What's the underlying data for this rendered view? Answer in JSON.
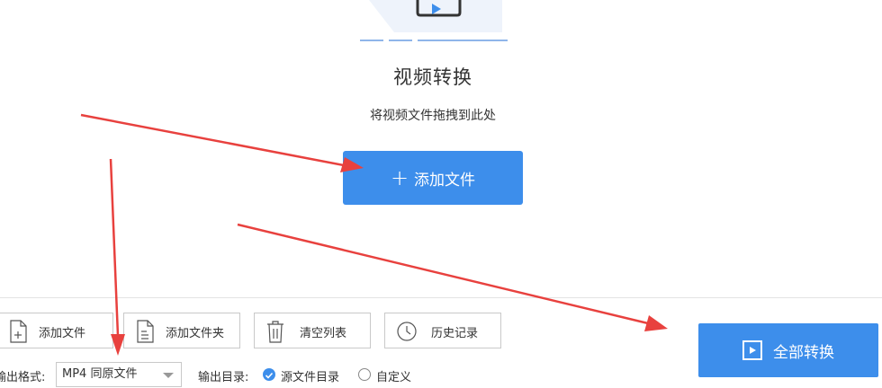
{
  "header": {
    "title": "视频转换",
    "subtitle": "将视频文件拖拽到此处"
  },
  "add_file_main": {
    "label": "添加文件",
    "icon": "plus-icon"
  },
  "toolbar": {
    "add_file": "添加文件",
    "add_folder": "添加文件夹",
    "clear_list": "清空列表",
    "history": "历史记录"
  },
  "output": {
    "format_label": "输出格式:",
    "format_value": "MP4 同原文件",
    "dir_label": "输出目录:",
    "dir_option_source": "源文件目录",
    "dir_option_custom": "自定义",
    "selected": "源文件目录"
  },
  "convert_all": {
    "label": "全部转换",
    "icon": "play-icon"
  },
  "colors": {
    "accent": "#3d8eeb",
    "annotation_arrow": "#e8413e"
  }
}
